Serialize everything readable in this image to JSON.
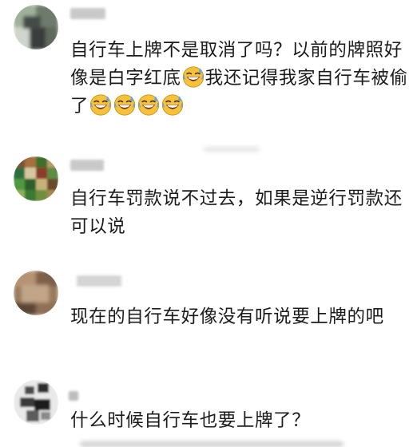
{
  "comments": [
    {
      "text_before": "自行车上牌不是取消了吗？以前的牌照好像是白字红底",
      "text_middle": "我还记得我家自行车被偷了",
      "emoji": "laughing-sweat-emoji"
    },
    {
      "text": "自行车罚款说不过去，如果是逆行罚款还可以说"
    },
    {
      "text": "现在的自行车好像没有听说要上牌的吧"
    },
    {
      "text": "什么时候自行车也要上牌了？"
    }
  ],
  "colors": {
    "text": "#1b1b1b",
    "background": "#ffffff",
    "emoji_face": "#f7c23b",
    "emoji_sweat": "#5aa9e6"
  }
}
